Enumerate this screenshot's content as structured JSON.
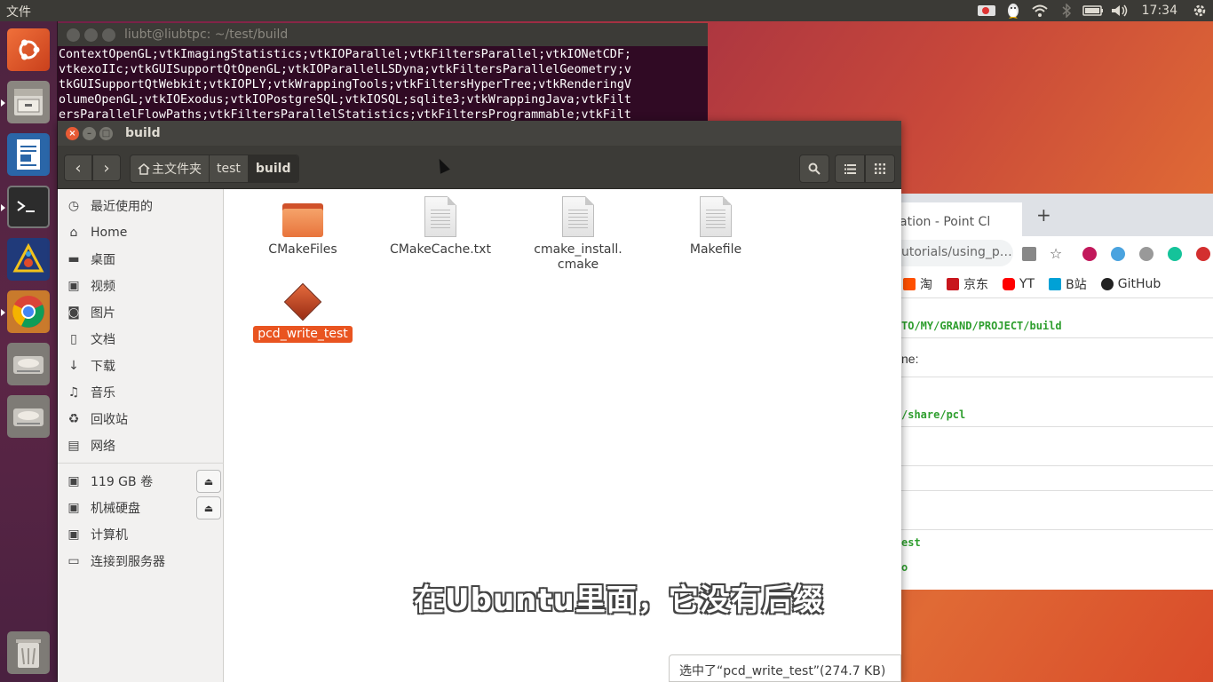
{
  "top_panel": {
    "app_menu": "文件",
    "indicators": {
      "record": "record-icon",
      "qq": "qq-penguin-icon",
      "wifi": "wifi-icon",
      "bluetooth": "bluetooth-icon",
      "battery": "battery-icon",
      "volume": "volume-icon",
      "settings": "gear-icon"
    },
    "clock": "17:34"
  },
  "launcher": {
    "items": [
      "ubuntu-dash",
      "files",
      "libreoffice-writer",
      "terminal",
      "kicad",
      "chrome",
      "drive-1",
      "drive-2",
      "trash"
    ]
  },
  "terminal": {
    "title": "liubt@liubtpc: ~/test/build",
    "lines": [
      "ContextOpenGL;vtkImagingStatistics;vtkIOParallel;vtkFiltersParallel;vtkIONetCDF;",
      "vtkexoIIc;vtkGUISupportQtOpenGL;vtkIOParallelLSDyna;vtkFiltersParallelGeometry;v",
      "tkGUISupportQtWebkit;vtkIOPLY;vtkWrappingTools;vtkFiltersHyperTree;vtkRenderingV",
      "olumeOpenGL;vtkIOExodus;vtkIOPostgreSQL;vtkIOSQL;sqlite3;vtkWrappingJava;vtkFilt",
      "ersParallelFlowPaths;vtkFiltersParallelStatistics;vtkFiltersProgrammable;vtkFilt"
    ]
  },
  "chrome": {
    "tab_title": "ation - Point Cl",
    "new_tab": "+",
    "omnibox": "utorials/using_p…",
    "bookmarks": [
      {
        "label": "淘",
        "color": "#ff5000"
      },
      {
        "label": "京东",
        "color": "#c8161d"
      },
      {
        "label": "YT",
        "color": "#ff0000"
      },
      {
        "label": "B站",
        "color": "#00a1d6"
      },
      {
        "label": "GitHub",
        "color": "#222222"
      }
    ],
    "content_lines": [
      "TO/MY/GRAND/PROJECT/build",
      "ne:",
      "/share/pcl",
      "est",
      "o"
    ]
  },
  "files": {
    "title": "build",
    "breadcrumbs": [
      "主文件夹",
      "test",
      "build"
    ],
    "sidebar": {
      "places": [
        {
          "label": "最近使用的",
          "icon": "clock-icon"
        },
        {
          "label": "Home",
          "icon": "home-icon"
        },
        {
          "label": "桌面",
          "icon": "folder-icon"
        },
        {
          "label": "视频",
          "icon": "video-icon"
        },
        {
          "label": "图片",
          "icon": "camera-icon"
        },
        {
          "label": "文档",
          "icon": "document-icon"
        },
        {
          "label": "下载",
          "icon": "download-icon"
        },
        {
          "label": "音乐",
          "icon": "music-icon"
        },
        {
          "label": "回收站",
          "icon": "trash-icon"
        },
        {
          "label": "网络",
          "icon": "network-icon"
        }
      ],
      "devices": [
        {
          "label": "119 GB 卷",
          "icon": "drive-icon",
          "eject": true
        },
        {
          "label": "机械硬盘",
          "icon": "drive-icon",
          "eject": true
        },
        {
          "label": "计算机",
          "icon": "computer-icon",
          "eject": false
        },
        {
          "label": "连接到服务器",
          "icon": "server-icon",
          "eject": false
        }
      ]
    },
    "items": [
      {
        "name": "CMakeFiles",
        "type": "folder"
      },
      {
        "name": "CMakeCache.txt",
        "type": "text"
      },
      {
        "name_line1": "cmake_install.",
        "name_line2": "cmake",
        "type": "text"
      },
      {
        "name": "Makefile",
        "type": "text"
      },
      {
        "name": "pcd_write_test",
        "type": "executable",
        "selected": true
      }
    ],
    "status": "选中了“pcd_write_test”(274.7 KB)"
  },
  "subtitle": "在Ubuntu里面，它没有后缀"
}
